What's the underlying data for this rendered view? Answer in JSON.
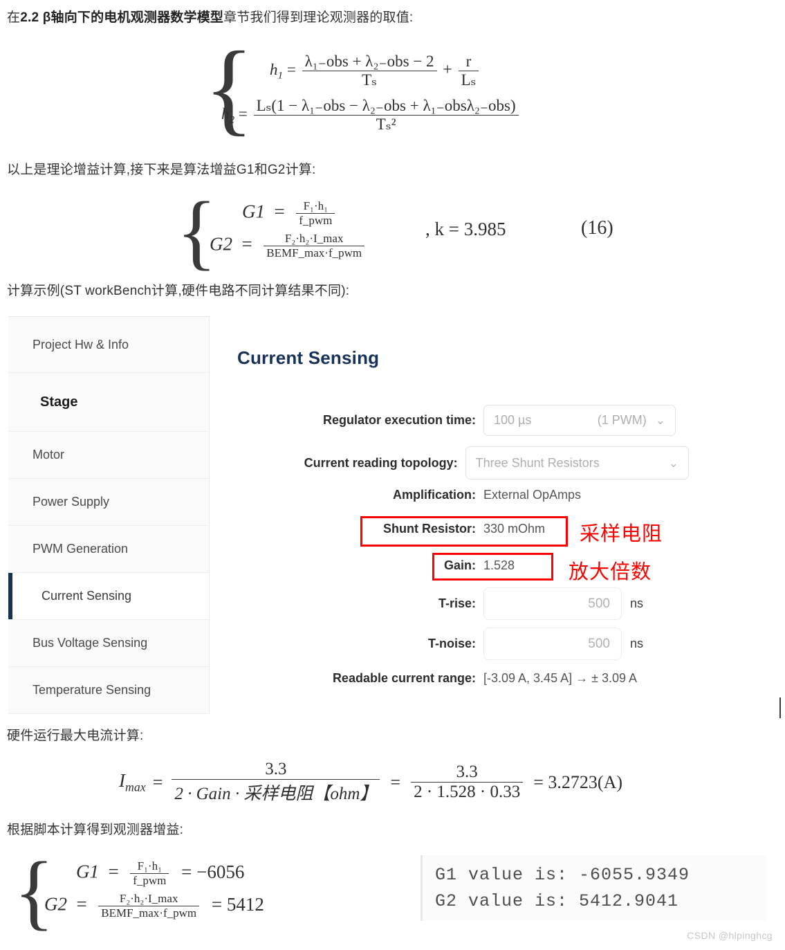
{
  "article": {
    "intro_prefix": "在",
    "intro_bold": "2.2 β轴向下的电机观测器数学模型",
    "intro_suffix": "章节我们得到理论观测器的取值:",
    "line_gains": "以上是理论增益计算,接下来是算法增益G1和G2计算:",
    "line_example": "计算示例(ST workBench计算,硬件电路不同计算结果不同):",
    "line_imax": "硬件运行最大电流计算:",
    "line_script": "根据脚本计算得到观测器增益:"
  },
  "formula_observer": {
    "h1_lhs": "h",
    "h1_sub": "1",
    "h1_num": "λ₁₋obs + λ₂₋obs − 2",
    "h1_den": "Tₛ",
    "h1_add_num": "r",
    "h1_add_den": "Lₛ",
    "h2_lhs": "h",
    "h2_sub": "2",
    "h2_num": "Lₛ(1 − λ₁₋obs − λ₂₋obs + λ₁₋obsλ₂₋obs)",
    "h2_den": "Tₛ²"
  },
  "formula_gain": {
    "g1_label": "G1",
    "g1_num": "F₁·h₁",
    "g1_den": "f_pwm",
    "g2_label": "G2",
    "g2_num": "F₂·h₂·I_max",
    "g2_den": "BEMF_max·f_pwm",
    "k_text": ", k = 3.985",
    "eq_number": "(16)"
  },
  "formula_imax": {
    "lhs": "I_max",
    "num1": "3.3",
    "den1": "2 · Gain · 采样电阻【ohm】",
    "num2": "3.3",
    "den2": "2 · 1.528 · 0.33",
    "result": "= 3.2723(A)"
  },
  "formula_result": {
    "g1_label": "G1",
    "g1_num": "F₁·h₁",
    "g1_den": "f_pwm",
    "g1_value": "= −6056",
    "g2_label": "G2",
    "g2_num": "F₂·h₂·I_max",
    "g2_den": "BEMF_max·f_pwm",
    "g2_value": "= 5412"
  },
  "workbench": {
    "sidebar": {
      "items": [
        {
          "label": "Project Hw & Info",
          "type": "item",
          "selected": false
        },
        {
          "label": "Stage",
          "type": "header",
          "selected": false
        },
        {
          "label": "Motor",
          "type": "item",
          "selected": false
        },
        {
          "label": "Power Supply",
          "type": "item",
          "selected": false
        },
        {
          "label": "PWM Generation",
          "type": "item",
          "selected": false
        },
        {
          "label": "Current Sensing",
          "type": "item",
          "selected": true
        },
        {
          "label": "Bus Voltage Sensing",
          "type": "item",
          "selected": false
        },
        {
          "label": "Temperature Sensing",
          "type": "item",
          "selected": false
        }
      ]
    },
    "title": "Current Sensing",
    "accent_color": "#17325a",
    "fields": {
      "regulator_label": "Regulator execution time:",
      "regulator_value": "100 µs",
      "regulator_secondary": "(1 PWM)",
      "topology_label": "Current reading topology:",
      "topology_value": "Three Shunt Resistors",
      "amplification_label": "Amplification:",
      "amplification_value": "External OpAmps",
      "shunt_label": "Shunt Resistor:",
      "shunt_value": "330 mOhm",
      "gain_label": "Gain:",
      "gain_value": "1.528",
      "trise_label": "T-rise:",
      "trise_value": "500",
      "trise_unit": "ns",
      "tnoise_label": "T-noise:",
      "tnoise_value": "500",
      "tnoise_unit": "ns",
      "range_label": "Readable current range:",
      "range_value": "[-3.09 A, 3.45 A] → ± 3.09 A"
    },
    "annotations": {
      "shunt": "采样电阻",
      "gain": "放大倍数",
      "color": "#ff0000"
    },
    "chevron_icon": "⌄"
  },
  "console": {
    "line1": "G1 value is: -6055.9349",
    "line2": "G2 value is: 5412.9041"
  },
  "watermark": "CSDN @hlpinghcg"
}
